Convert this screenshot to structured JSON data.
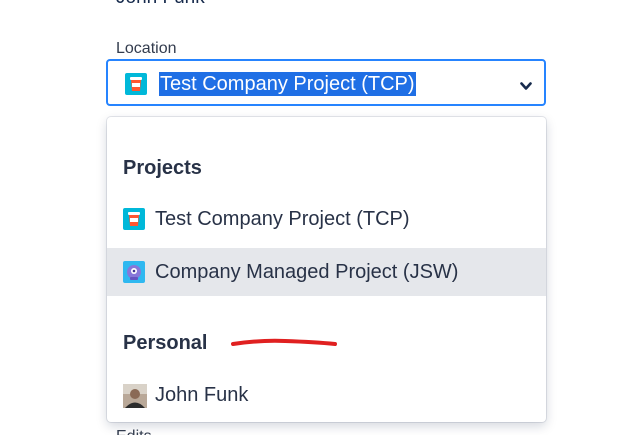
{
  "form": {
    "previous_field_value": "John Funk",
    "location_label": "Location",
    "location_selected": "Test Company Project (TCP)",
    "next_field_label": "Edits"
  },
  "dropdown": {
    "groups": [
      {
        "heading": "Projects",
        "items": [
          {
            "label": "Test Company Project (TCP)",
            "icon": "coffee-cup-project-icon"
          },
          {
            "label": "Company Managed Project (JSW)",
            "icon": "robot-project-icon",
            "highlighted": true
          }
        ]
      },
      {
        "heading": "Personal",
        "items": [
          {
            "label": "John Funk",
            "icon": "user-avatar"
          }
        ]
      }
    ]
  },
  "colors": {
    "focus_border": "#2684ff",
    "selection_highlight": "#1f6fe5",
    "hover_background": "#e5e7eb",
    "annotation_red": "#e02020"
  }
}
